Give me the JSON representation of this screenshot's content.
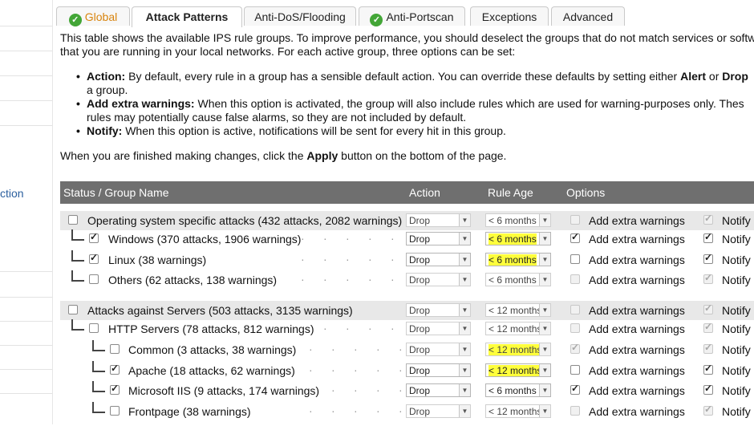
{
  "tabs": [
    {
      "label": "Global",
      "icon": "check-icon",
      "active": false
    },
    {
      "label": "Attack Patterns",
      "active": true
    },
    {
      "label": "Anti-DoS/Flooding",
      "active": false
    },
    {
      "label": "Anti-Portscan",
      "icon": "check-icon",
      "active": false
    },
    {
      "label": "Exceptions",
      "active": false
    },
    {
      "label": "Advanced",
      "active": false
    }
  ],
  "sidebar": {
    "fragment": "ction"
  },
  "intro": {
    "line1": "This table shows the available IPS rule groups. To improve performance, you should deselect the groups that do not match services or softw",
    "line2": "that you are running in your local networks. For each active group, three options can be set:",
    "bullets": [
      {
        "term": "Action:",
        "text": " By default, every rule in a group has a sensible default action. You can override these defaults by setting either ",
        "b1": "Alert",
        "mid": " or ",
        "b2": "Drop",
        "cont": "a group."
      },
      {
        "term": "Add extra warnings:",
        "text": " When this option is activated, the group will also include rules which are used for warning-purposes only. Thes",
        "cont": "rules may potentially cause false alarms, so they are not included by default."
      },
      {
        "term": "Notify:",
        "text": " When this option is active, notifications will be sent for every hit in this group."
      }
    ],
    "finish_pre": "When you are finished making changes, click the ",
    "finish_bold": "Apply",
    "finish_post": " button on the bottom of the page."
  },
  "table": {
    "headers": {
      "name": "Status / Group Name",
      "action": "Action",
      "age": "Rule Age",
      "options": "Options"
    },
    "warn_label": "Add extra warnings",
    "notify_label": "Notify",
    "rows": [
      {
        "type": "group",
        "level": 0,
        "checked": false,
        "name": "Operating system specific attacks (432 attacks, 2082 warnings)",
        "action": "Drop",
        "age": "< 6 months",
        "age_hl": false,
        "warn": false,
        "warn_dis": true,
        "notify": true,
        "notify_dis": true
      },
      {
        "type": "item",
        "level": 1,
        "checked": true,
        "name": "Windows (370 attacks, 1906 warnings)",
        "action": "Drop",
        "age": "< 6 months",
        "age_hl": true,
        "warn": true,
        "warn_dis": false,
        "notify": true,
        "notify_dis": false
      },
      {
        "type": "item",
        "level": 1,
        "checked": true,
        "name": "Linux (38 warnings)",
        "action": "Drop",
        "age": "< 6 months",
        "age_hl": true,
        "warn": false,
        "warn_dis": false,
        "notify": true,
        "notify_dis": false
      },
      {
        "type": "item",
        "level": 1,
        "checked": false,
        "name": "Others (62 attacks, 138 warnings)",
        "action": "Drop",
        "age": "< 6 months",
        "age_hl": false,
        "warn": false,
        "warn_dis": true,
        "notify": true,
        "notify_dis": true
      },
      {
        "type": "spacer"
      },
      {
        "type": "group",
        "level": 0,
        "checked": false,
        "name": "Attacks against Servers (503 attacks, 3135 warnings)",
        "action": "Drop",
        "age": "< 12 months",
        "age_hl": false,
        "warn": false,
        "warn_dis": true,
        "notify": true,
        "notify_dis": true
      },
      {
        "type": "item",
        "level": 1,
        "checked": false,
        "name": "HTTP Servers (78 attacks, 812 warnings)",
        "action": "Drop",
        "age": "< 12 months",
        "age_hl": false,
        "warn": false,
        "warn_dis": true,
        "notify": true,
        "notify_dis": true
      },
      {
        "type": "item",
        "level": 2,
        "checked": false,
        "name": "Common (3 attacks, 38 warnings)",
        "action": "Drop",
        "age": "< 12 months",
        "age_hl": true,
        "warn": true,
        "warn_dis": true,
        "notify": true,
        "notify_dis": true
      },
      {
        "type": "item",
        "level": 2,
        "checked": true,
        "name": "Apache (18 attacks, 62 warnings)",
        "action": "Drop",
        "age": "< 12 months",
        "age_hl": true,
        "warn": false,
        "warn_dis": false,
        "notify": true,
        "notify_dis": false
      },
      {
        "type": "item",
        "level": 2,
        "checked": true,
        "name": "Microsoft IIS (9 attacks, 174 warnings)",
        "action": "Drop",
        "age": "< 6 months",
        "age_hl": false,
        "warn": true,
        "warn_dis": false,
        "notify": true,
        "notify_dis": false
      },
      {
        "type": "item",
        "level": 2,
        "checked": false,
        "name": "Frontpage (38 warnings)",
        "action": "Drop",
        "age": "< 12 months",
        "age_hl": false,
        "warn": false,
        "warn_dis": true,
        "notify": true,
        "notify_dis": true
      }
    ]
  },
  "colors": {
    "tab_accent": "#d8840e",
    "check_green": "#43a637",
    "header_bg": "#6f6f6f",
    "highlight": "#ffff3c",
    "link": "#2b5f9e"
  }
}
